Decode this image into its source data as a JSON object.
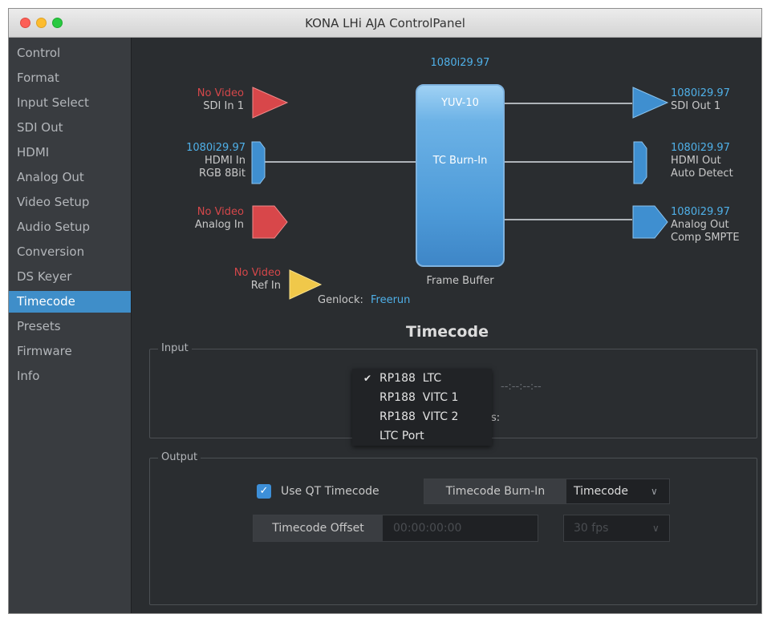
{
  "window": {
    "title": "KONA LHi AJA ControlPanel"
  },
  "sidebar": {
    "items": [
      {
        "label": "Control"
      },
      {
        "label": "Format"
      },
      {
        "label": "Input Select"
      },
      {
        "label": "SDI Out"
      },
      {
        "label": "HDMI"
      },
      {
        "label": "Analog Out"
      },
      {
        "label": "Video Setup"
      },
      {
        "label": "Audio Setup"
      },
      {
        "label": "Conversion"
      },
      {
        "label": "DS Keyer"
      },
      {
        "label": "Timecode"
      },
      {
        "label": "Presets"
      },
      {
        "label": "Firmware"
      },
      {
        "label": "Info"
      }
    ],
    "active": "Timecode"
  },
  "diagram": {
    "frame_buffer": {
      "format": "1080i29.97",
      "color": "YUV-10",
      "burn": "TC Burn-In",
      "label": "Frame Buffer"
    },
    "inputs": {
      "sdi": {
        "status": "No Video",
        "name": "SDI In 1"
      },
      "hdmi": {
        "status": "1080i29.97",
        "name": "HDMI In",
        "detail": "RGB 8Bit"
      },
      "analog": {
        "status": "No Video",
        "name": "Analog In"
      },
      "ref": {
        "status": "No Video",
        "name": "Ref In"
      }
    },
    "outputs": {
      "sdi": {
        "status": "1080i29.97",
        "name": "SDI Out 1"
      },
      "hdmi": {
        "status": "1080i29.97",
        "name": "HDMI Out",
        "detail": "Auto Detect"
      },
      "analog": {
        "status": "1080i29.97",
        "name": "Analog Out",
        "detail": "Comp SMPTE"
      }
    },
    "genlock": {
      "label": "Genlock:",
      "value": "Freerun"
    },
    "colors": {
      "blue_port": "#3f8fd0",
      "red_port": "#d8474a",
      "yellow_port": "#f0c84a",
      "accent": "#4fb0e8"
    }
  },
  "timecode": {
    "title": "Timecode",
    "input": {
      "legend": "Input",
      "menu": [
        {
          "label": "RP188  LTC",
          "checked": true
        },
        {
          "label": "RP188  VITC 1",
          "checked": false
        },
        {
          "label": "RP188  VITC 2",
          "checked": false
        },
        {
          "label": "LTC Port",
          "checked": false
        }
      ],
      "timecode_value": "--:--:--:--",
      "partial_label": "s:"
    },
    "output": {
      "legend": "Output",
      "use_qt_label": "Use QT Timecode",
      "use_qt_checked": true,
      "burn_in_label": "Timecode Burn-In",
      "burn_in_value": "Timecode",
      "offset_label": "Timecode Offset",
      "offset_value": "00:00:00:00",
      "fps_value": "30 fps"
    }
  }
}
